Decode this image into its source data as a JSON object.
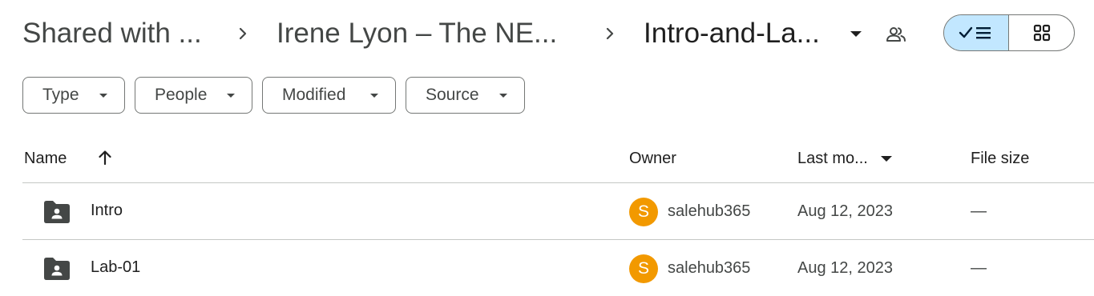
{
  "breadcrumb": {
    "items": [
      "Shared with ...",
      "Irene Lyon – The NE...",
      "Intro-and-La..."
    ]
  },
  "icons": {
    "separator": "chevron-right-icon",
    "folder_menu": "arrow-drop-down-icon",
    "share": "people-icon",
    "list_view": "check-list-icon",
    "grid_view": "grid-icon",
    "shared_folder": "shared-folder-icon"
  },
  "view": {
    "selected": "list"
  },
  "filters": [
    "Type",
    "People",
    "Modified",
    "Source"
  ],
  "table": {
    "columns": {
      "name": "Name",
      "owner": "Owner",
      "last_modified": "Last mo...",
      "file_size": "File size"
    },
    "sort": {
      "column": "name",
      "direction": "ascending"
    },
    "rows": [
      {
        "name": "Intro",
        "owner_initial": "S",
        "owner": "salehub365",
        "modified": "Aug 12, 2023",
        "size": "—"
      },
      {
        "name": "Lab-01",
        "owner_initial": "S",
        "owner": "salehub365",
        "modified": "Aug 12, 2023",
        "size": "—"
      }
    ]
  },
  "colors": {
    "avatar": "#f29900",
    "active_toggle": "#c2e7ff",
    "border": "#747775",
    "divider": "#c4c7c5"
  }
}
